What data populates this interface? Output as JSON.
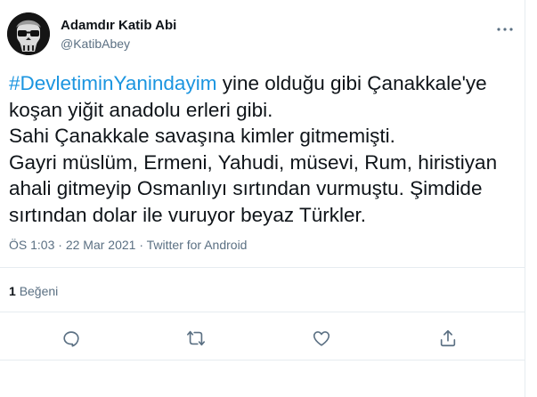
{
  "author": {
    "display_name": "Adamdır Katib Abi",
    "handle": "@KatibAbey",
    "avatar_icon": "skull-avatar-icon"
  },
  "tweet": {
    "hashtag": "#DevletiminYanindayim",
    "body": " yine olduğu gibi Çanakkale'ye\nkoşan yiğit anadolu erleri gibi.\nSahi Çanakkale savaşına kimler gitmemişti.\nGayri müslüm, Ermeni, Yahudi, müsevi, Rum, hiristiyan\nahali gitmeyip Osmanlıyı sırtından vurmuştu. Şimdide\nsırtından dolar ile vuruyor beyaz Türkler."
  },
  "meta": {
    "time": "ÖS 1:03",
    "date": "22 Mar 2021",
    "source": "Twitter for Android",
    "separator": "·"
  },
  "stats": {
    "like_count": "1",
    "like_label": "Beğeni"
  },
  "actions": [
    "reply-icon",
    "retweet-icon",
    "like-icon",
    "share-icon"
  ],
  "colors": {
    "hashtag": "#1b95e0",
    "secondary_text": "#5b7083",
    "divider": "#e6ecf0"
  }
}
